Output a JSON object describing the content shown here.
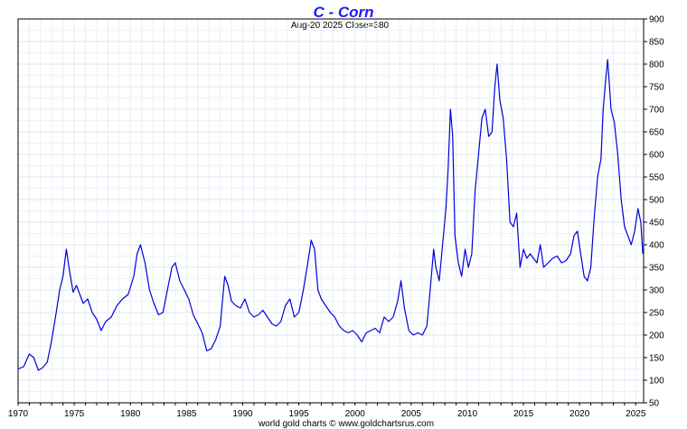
{
  "chart_data": {
    "type": "line",
    "title": "C  -  Corn",
    "subtitle": "Aug-20  2025   Close=380",
    "credit": "world gold charts © www.goldchartsrus.com",
    "xlabel": "",
    "ylabel": "",
    "xlim": [
      1970,
      2025.7
    ],
    "ylim": [
      50,
      900
    ],
    "x_ticks": [
      1970,
      1975,
      1980,
      1985,
      1990,
      1995,
      2000,
      2005,
      2010,
      2015,
      2020,
      2025
    ],
    "x_tick_labels": [
      "1970",
      "1975",
      "1980",
      "1985",
      "1990",
      "1995",
      "2000",
      "2005",
      "2010",
      "2015",
      "2020",
      "2025"
    ],
    "y_ticks": [
      50,
      100,
      150,
      200,
      250,
      300,
      350,
      400,
      450,
      500,
      550,
      600,
      650,
      700,
      750,
      800,
      850,
      900
    ],
    "y_tick_labels": [
      "50",
      "100",
      "150",
      "200",
      "250",
      "300",
      "350",
      "400",
      "450",
      "500",
      "550",
      "600",
      "650",
      "700",
      "750",
      "800",
      "850",
      "900"
    ],
    "y_axis_side": "right",
    "grid": true,
    "line_color": "#0000dd",
    "series": [
      {
        "x": [
          1970.0,
          1970.5,
          1971.0,
          1971.4,
          1971.8,
          1972.2,
          1972.6,
          1973.0,
          1973.4,
          1973.7,
          1974.0,
          1974.3,
          1974.6,
          1974.9,
          1975.2,
          1975.5,
          1975.8,
          1976.2,
          1976.6,
          1977.0,
          1977.4,
          1977.8,
          1978.3,
          1978.8,
          1979.3,
          1979.8,
          1980.3,
          1980.6,
          1980.9,
          1981.3,
          1981.7,
          1982.1,
          1982.5,
          1982.9,
          1983.3,
          1983.7,
          1984.0,
          1984.4,
          1984.8,
          1985.2,
          1985.6,
          1986.0,
          1986.4,
          1986.8,
          1987.2,
          1987.6,
          1988.0,
          1988.4,
          1988.7,
          1989.0,
          1989.4,
          1989.8,
          1990.2,
          1990.6,
          1991.0,
          1991.4,
          1991.8,
          1992.2,
          1992.6,
          1993.0,
          1993.4,
          1993.8,
          1994.2,
          1994.6,
          1995.0,
          1995.4,
          1995.8,
          1996.1,
          1996.4,
          1996.7,
          1997.0,
          1997.4,
          1997.8,
          1998.2,
          1998.6,
          1999.0,
          1999.4,
          1999.8,
          2000.2,
          2000.6,
          2001.0,
          2001.4,
          2001.8,
          2002.2,
          2002.6,
          2003.0,
          2003.4,
          2003.8,
          2004.1,
          2004.4,
          2004.8,
          2005.2,
          2005.6,
          2006.0,
          2006.4,
          2006.7,
          2007.0,
          2007.2,
          2007.5,
          2007.8,
          2008.1,
          2008.3,
          2008.5,
          2008.7,
          2008.9,
          2009.2,
          2009.5,
          2009.8,
          2010.1,
          2010.4,
          2010.7,
          2011.0,
          2011.3,
          2011.6,
          2011.9,
          2012.2,
          2012.45,
          2012.65,
          2012.9,
          2013.2,
          2013.5,
          2013.8,
          2014.1,
          2014.4,
          2014.7,
          2015.0,
          2015.3,
          2015.6,
          2015.9,
          2016.2,
          2016.5,
          2016.8,
          2017.2,
          2017.6,
          2018.0,
          2018.4,
          2018.8,
          2019.2,
          2019.5,
          2019.8,
          2020.1,
          2020.4,
          2020.7,
          2021.0,
          2021.3,
          2021.6,
          2021.9,
          2022.1,
          2022.3,
          2022.5,
          2022.8,
          2023.1,
          2023.4,
          2023.7,
          2024.0,
          2024.3,
          2024.6,
          2024.9,
          2025.2,
          2025.45,
          2025.63
        ],
        "y": [
          125,
          130,
          158,
          150,
          122,
          128,
          140,
          190,
          250,
          300,
          330,
          390,
          340,
          295,
          310,
          290,
          270,
          280,
          250,
          235,
          210,
          230,
          240,
          265,
          280,
          290,
          330,
          380,
          400,
          360,
          300,
          270,
          245,
          250,
          300,
          350,
          360,
          320,
          300,
          280,
          245,
          225,
          205,
          165,
          170,
          190,
          220,
          330,
          310,
          275,
          265,
          260,
          280,
          250,
          240,
          245,
          255,
          240,
          225,
          220,
          230,
          265,
          280,
          240,
          250,
          300,
          360,
          410,
          390,
          300,
          280,
          265,
          250,
          240,
          220,
          210,
          205,
          210,
          200,
          185,
          205,
          210,
          215,
          205,
          240,
          230,
          240,
          275,
          320,
          260,
          210,
          200,
          205,
          200,
          220,
          300,
          390,
          350,
          320,
          400,
          480,
          570,
          700,
          640,
          420,
          360,
          330,
          390,
          350,
          380,
          520,
          600,
          680,
          700,
          640,
          650,
          750,
          800,
          720,
          680,
          590,
          450,
          440,
          470,
          350,
          390,
          370,
          380,
          370,
          360,
          400,
          350,
          360,
          370,
          375,
          360,
          365,
          380,
          420,
          430,
          380,
          330,
          320,
          350,
          460,
          550,
          590,
          700,
          760,
          810,
          700,
          670,
          600,
          500,
          440,
          420,
          400,
          430,
          480,
          450,
          380
        ]
      }
    ]
  }
}
